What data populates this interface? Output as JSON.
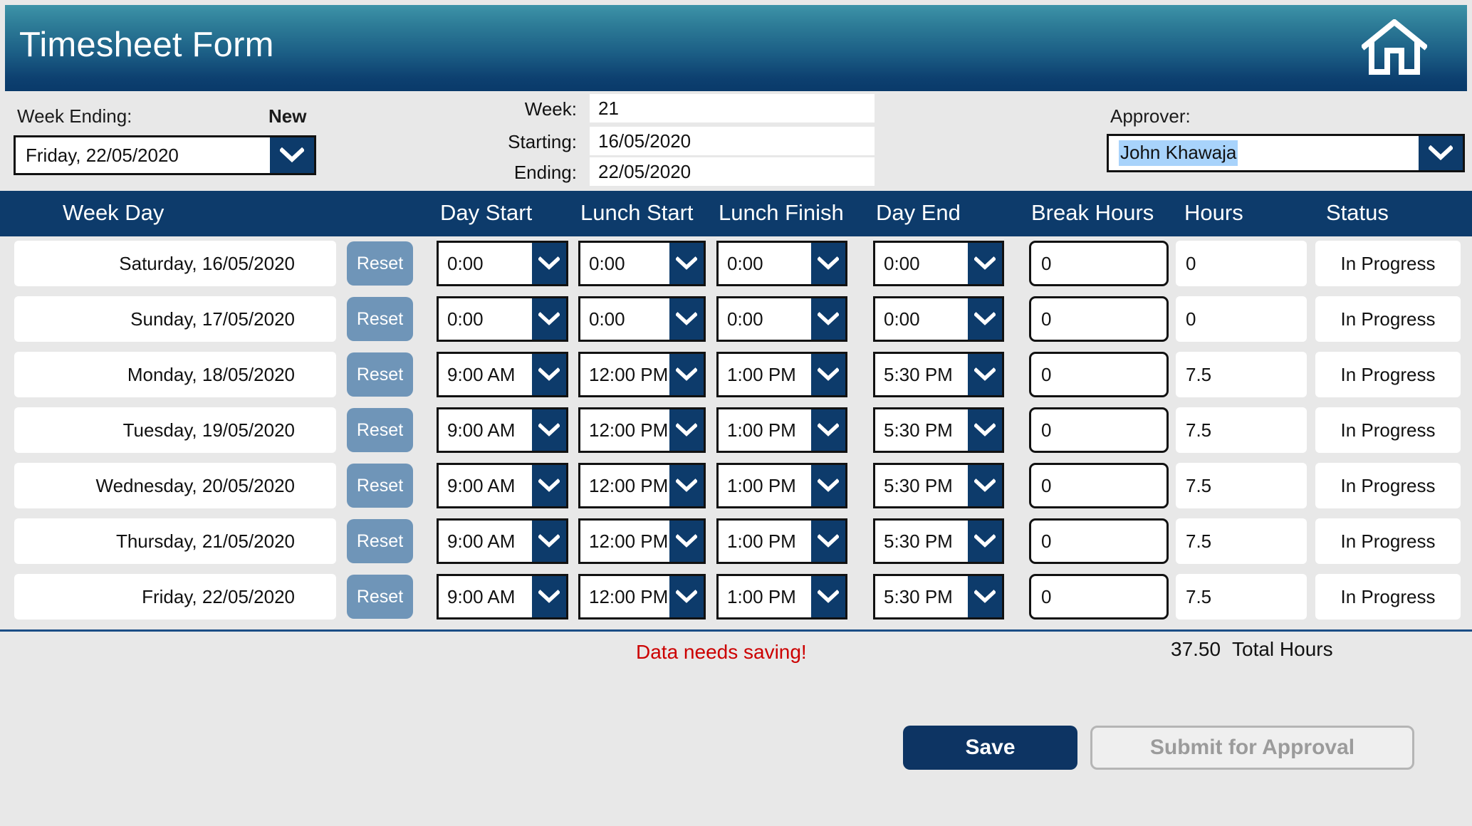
{
  "header": {
    "title": "Timesheet Form",
    "home_icon": "home-icon"
  },
  "info": {
    "week_ending_label": "Week Ending:",
    "status_badge": "New",
    "week_ending_value": "Friday, 22/05/2020",
    "week_label": "Week:",
    "week_value": "21",
    "starting_label": "Starting:",
    "starting_value": "16/05/2020",
    "ending_label": "Ending:",
    "ending_value": "22/05/2020",
    "approver_label": "Approver:",
    "approver_value": "John Khawaja"
  },
  "table": {
    "columns": [
      "Week Day",
      "Day Start",
      "Lunch Start",
      "Lunch Finish",
      "Day End",
      "Break Hours",
      "Hours",
      "Status"
    ],
    "reset_label": "Reset",
    "rows": [
      {
        "day": "Saturday, 16/05/2020",
        "day_start": "0:00",
        "lunch_start": "0:00",
        "lunch_finish": "0:00",
        "day_end": "0:00",
        "break_hours": "0",
        "hours": "0",
        "status": "In Progress"
      },
      {
        "day": "Sunday, 17/05/2020",
        "day_start": "0:00",
        "lunch_start": "0:00",
        "lunch_finish": "0:00",
        "day_end": "0:00",
        "break_hours": "0",
        "hours": "0",
        "status": "In Progress"
      },
      {
        "day": "Monday, 18/05/2020",
        "day_start": "9:00 AM",
        "lunch_start": "12:00 PM",
        "lunch_finish": "1:00 PM",
        "day_end": "5:30 PM",
        "break_hours": "0",
        "hours": "7.5",
        "status": "In Progress"
      },
      {
        "day": "Tuesday, 19/05/2020",
        "day_start": "9:00 AM",
        "lunch_start": "12:00 PM",
        "lunch_finish": "1:00 PM",
        "day_end": "5:30 PM",
        "break_hours": "0",
        "hours": "7.5",
        "status": "In Progress"
      },
      {
        "day": "Wednesday, 20/05/2020",
        "day_start": "9:00 AM",
        "lunch_start": "12:00 PM",
        "lunch_finish": "1:00 PM",
        "day_end": "5:30 PM",
        "break_hours": "0",
        "hours": "7.5",
        "status": "In Progress"
      },
      {
        "day": "Thursday, 21/05/2020",
        "day_start": "9:00 AM",
        "lunch_start": "12:00 PM",
        "lunch_finish": "1:00 PM",
        "day_end": "5:30 PM",
        "break_hours": "0",
        "hours": "7.5",
        "status": "In Progress"
      },
      {
        "day": "Friday, 22/05/2020",
        "day_start": "9:00 AM",
        "lunch_start": "12:00 PM",
        "lunch_finish": "1:00 PM",
        "day_end": "5:30 PM",
        "break_hours": "0",
        "hours": "7.5",
        "status": "In Progress"
      }
    ]
  },
  "footer": {
    "save_message": "Data needs saving!",
    "total_hours_value": "37.50",
    "total_hours_label": "Total Hours",
    "save_label": "Save",
    "submit_label": "Submit for Approval"
  },
  "colors": {
    "header_gradient_top": "#3d93a8",
    "header_gradient_bottom": "#093a6a",
    "navy": "#0d3b6b",
    "page_background": "#e8e8e8",
    "reset_button": "#6f95b8",
    "selection_highlight": "#a8d3fb",
    "warning_text": "#cc0000",
    "disabled_text": "#9b9b9b"
  }
}
